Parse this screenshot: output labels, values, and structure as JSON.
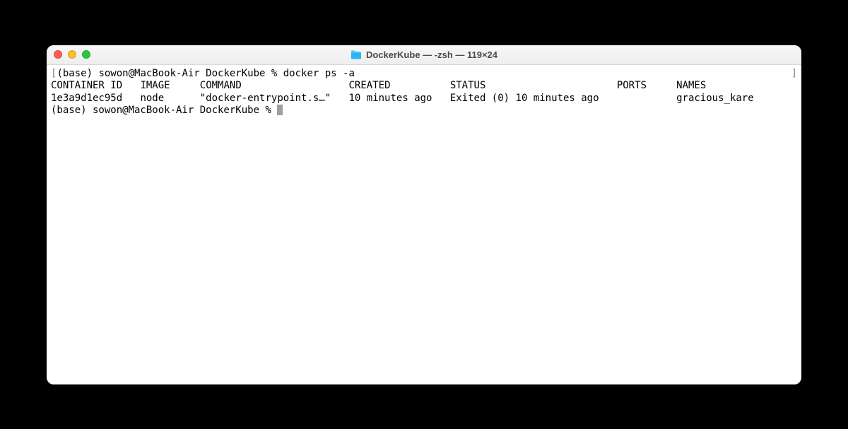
{
  "window": {
    "title": "DockerKube — -zsh — 119×24"
  },
  "terminal": {
    "line1_bracket_open": "[",
    "line1_prompt": "(base) sowon@MacBook-Air DockerKube % ",
    "line1_command": "docker ps -a",
    "line1_bracket_close": "]",
    "header_container_id": "CONTAINER ID",
    "header_image": "IMAGE",
    "header_command": "COMMAND",
    "header_created": "CREATED",
    "header_status": "STATUS",
    "header_ports": "PORTS",
    "header_names": "NAMES",
    "row_container_id": "1e3a9d1ec95d",
    "row_image": "node",
    "row_command": "\"docker-entrypoint.s…\"",
    "row_created": "10 minutes ago",
    "row_status": "Exited (0) 10 minutes ago",
    "row_ports": "",
    "row_names": "gracious_kare",
    "line4_prompt": "(base) sowon@MacBook-Air DockerKube % "
  }
}
